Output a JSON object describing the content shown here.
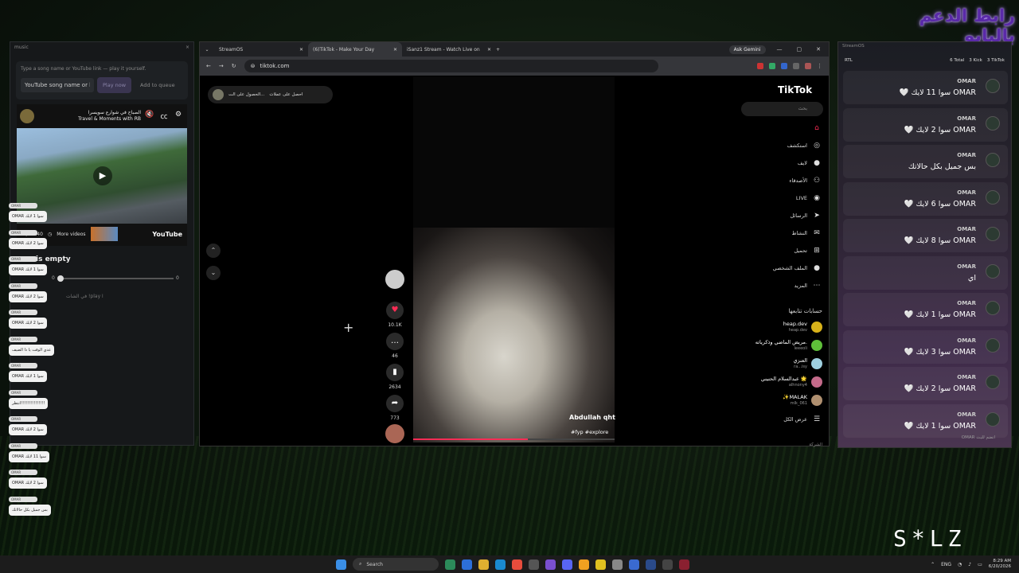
{
  "promo_text": "رابط الدعم بالبايو",
  "music": {
    "title": "music",
    "close": "×",
    "hint": "Type a song name or YouTube link — play it yourself.",
    "input_value": "YouTube song name or l",
    "play": "Play now",
    "queue": "Add to queue",
    "yt": {
      "title": "الصباح في شوارع سويسرا",
      "channel": "Travel & Moments with RB",
      "time": "0 / 27:40",
      "more": "More videos",
      "logo": "YouTube"
    },
    "queue_empty": "is empty",
    "zero_left": "0",
    "zero_right": "0",
    "partial_line": "في الشات !play ا"
  },
  "overlay_bubbles": [
    "OMAR سوا 1 لايك",
    "OMAR سوا 2 لايك",
    "OMAR سوا 1 لايك",
    "OMAR سوا 2 لايك",
    "OMAR سوا 2 لايك",
    "عدي الوقت يا ذا الضيف",
    "OMAR سوا 1 لايك",
    "انتظر!!!!!!!!!!!!!!!",
    "OMAR سوا 2 لايك",
    "OMAR سوا 11 لايك",
    "OMAR سوا 2 لايك",
    "بس جميل بكل حالاتك"
  ],
  "overlay_tag": "OMAR",
  "browser": {
    "tabs": [
      {
        "label": "StreamOS"
      },
      {
        "label": "(6)TikTok - Make Your Day"
      },
      {
        "label": "iSanz1 Stream - Watch Live on"
      }
    ],
    "new_tab": "+",
    "gemini": "Ask Gemini",
    "url": "tiktok.com"
  },
  "tiktok": {
    "logo": "TikTok",
    "search_placeholder": "بحث",
    "pill": {
      "left": "الحصول على الت...",
      "right": "احصل على عملات"
    },
    "nav": [
      {
        "label": "",
        "icon": "home-icon"
      },
      {
        "label": "استكشف",
        "icon": "compass-icon"
      },
      {
        "label": "لايف",
        "icon": "avatar"
      },
      {
        "label": "الأصدقاء",
        "icon": "friends-icon"
      },
      {
        "label": "LIVE",
        "icon": "live-icon"
      },
      {
        "label": "الرسائل",
        "icon": "send-icon"
      },
      {
        "label": "النشاط",
        "icon": "message-icon"
      },
      {
        "label": "تحميل",
        "icon": "upload-icon"
      },
      {
        "label": "الملف الشخصي",
        "icon": "avatar"
      },
      {
        "label": "المزيد",
        "icon": "more-icon"
      }
    ],
    "following_header": "حسابات تتابعها",
    "following": [
      {
        "name": "heap.dev",
        "handle": "heap.dev",
        "color": "#d8b21a"
      },
      {
        "name": "مريض الماضي وذكرياته.",
        "handle": "leeeoli",
        "color": "#5fbf3a"
      },
      {
        "name": "العنزي",
        "handle": "ra...isy",
        "color": "#9fd0e0"
      },
      {
        "name": "عبدالسلام الحنيني 🌟",
        "handle": "alhnony4",
        "color": "#c46a8a"
      },
      {
        "name": "✨MALAK",
        "handle": "mlk_061",
        "color": "#b09070"
      }
    ],
    "show_all": "عرض الكل",
    "company": "الشركة",
    "video": {
      "author": "Abdullah qht",
      "tags": "#fyp #explore",
      "progress": 0.57
    },
    "counts": {
      "likes": "10.1K",
      "comments": "46",
      "saves": "2634",
      "shares": "773"
    }
  },
  "streamos": {
    "title": "StreamOS",
    "rtl": "RTL",
    "total": "6 Total",
    "kick": "3 Kick",
    "tiktok": "3 TikTok",
    "zero_a": "0",
    "zero_b": "0",
    "messages": [
      {
        "user": "OMAR",
        "text": "OMAR سوا 11 لايك 🤍"
      },
      {
        "user": "OMAR",
        "text": "OMAR سوا 2 لايك 🤍"
      },
      {
        "user": "OMAR",
        "text": "بس جميل بكل حالاتك"
      },
      {
        "user": "OMAR",
        "text": "OMAR سوا 6 لايك 🤍"
      },
      {
        "user": "OMAR",
        "text": "OMAR سوا 8 لايك 🤍"
      },
      {
        "user": "OMAR",
        "text": "اي"
      },
      {
        "user": "OMAR",
        "text": "OMAR سوا 1 لايك 🤍"
      },
      {
        "user": "OMAR",
        "text": "OMAR سوا 3 لايك 🤍"
      },
      {
        "user": "OMAR",
        "text": "OMAR سوا 2 لايك 🤍"
      },
      {
        "user": "OMAR",
        "text": "OMAR سوا 1 لايك 🤍"
      }
    ],
    "footer": "OMAR انضم للبث"
  },
  "brand": "S*LZ",
  "taskbar": {
    "search": "Search",
    "lang": "ENG",
    "time": "8:29 AM",
    "date": "6/20/2026"
  }
}
